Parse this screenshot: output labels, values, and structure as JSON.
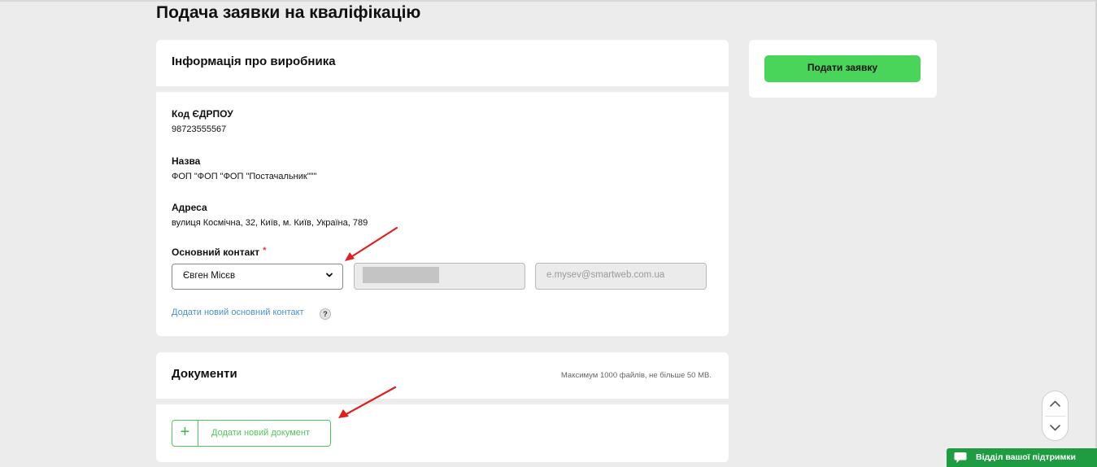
{
  "page": {
    "title": "Подача заявки на кваліфікацію"
  },
  "manufacturer": {
    "section_title": "Інформація про виробника",
    "edrpou_label": "Код ЄДРПОУ",
    "edrpou_value": "98723555567",
    "name_label": "Назва",
    "name_value": "ФОП \"ФОП \"ФОП \"Постачальник\"\"\"",
    "address_label": "Адреса",
    "address_value": "вулиця Космічна, 32, Київ, м. Київ, Україна, 789",
    "contact_label": "Основний контакт",
    "required_mark": "*",
    "contact_selected": "Євген Місєв",
    "contact_phone_value": "",
    "contact_email_value": "e.mysev@smartweb.com.ua",
    "add_contact_link": "Додати новий основний контакт",
    "help_symbol": "?"
  },
  "documents": {
    "section_title": "Документи",
    "limit_note": "Максимум 1000 файлів, не більше 50 MB.",
    "add_button_label": "Додати новий документ",
    "add_button_symbol": "+"
  },
  "sidebar": {
    "submit_label": "Подати заявку"
  },
  "support": {
    "label": "Відділ вашої підтримки"
  },
  "colors": {
    "accent_green": "#48d55a",
    "support_green": "#1f9c42",
    "link_blue": "#4a8fce",
    "arrow_red": "#e01e1e"
  },
  "icons": {
    "select_chevron": "chevron-down-icon",
    "scroll_up": "chevron-up-icon",
    "scroll_down": "chevron-down-icon",
    "support": "chat-bubble-icon",
    "help": "question-icon",
    "add": "plus-icon"
  }
}
